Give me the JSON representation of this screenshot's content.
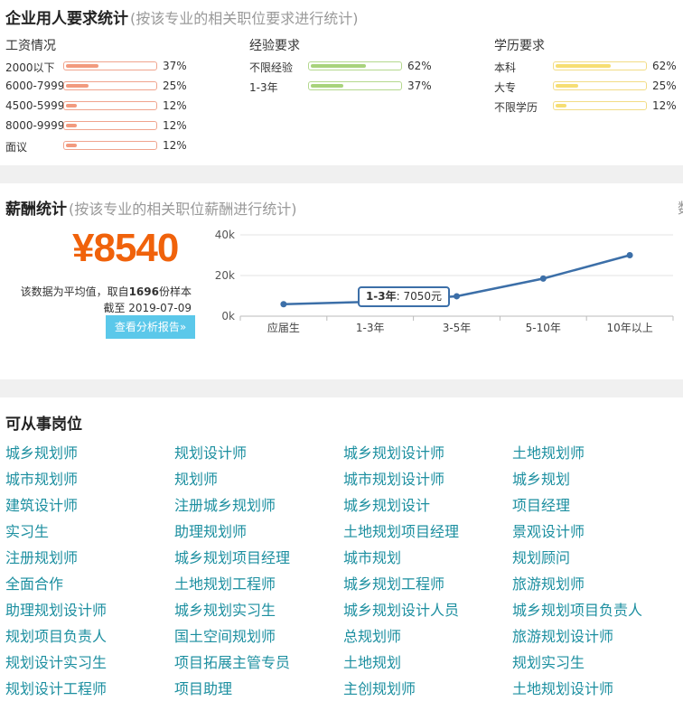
{
  "requirements": {
    "title": "企业用人要求统计",
    "subtitle": "(按该专业的相关职位要求进行统计)",
    "salary_col": {
      "title": "工资情况",
      "fill_color": "#f29a7e",
      "border_color": "#f0a48e",
      "items": [
        {
          "label": "2000以下",
          "pct": "37%",
          "value": 37
        },
        {
          "label": "6000-7999",
          "pct": "25%",
          "value": 25
        },
        {
          "label": "4500-5999",
          "pct": "12%",
          "value": 12
        },
        {
          "label": "8000-9999",
          "pct": "12%",
          "value": 12
        },
        {
          "label": "面议",
          "pct": "12%",
          "value": 12
        }
      ]
    },
    "experience_col": {
      "title": "经验要求",
      "fill_color": "#a8d37c",
      "border_color": "#b4d88e",
      "items": [
        {
          "label": "不限经验",
          "pct": "62%",
          "value": 62
        },
        {
          "label": "1-3年",
          "pct": "37%",
          "value": 37
        }
      ]
    },
    "education_col": {
      "title": "学历要求",
      "fill_color": "#f6de73",
      "border_color": "#f2dc86",
      "items": [
        {
          "label": "本科",
          "pct": "62%",
          "value": 62
        },
        {
          "label": "大专",
          "pct": "25%",
          "value": 25
        },
        {
          "label": "不限学历",
          "pct": "12%",
          "value": 12
        }
      ]
    }
  },
  "salary_stats": {
    "title": "薪酬统计",
    "subtitle": "(按该专业的相关职位薪酬进行统计)",
    "edge_text": "数",
    "amount": "¥8540",
    "note_prefix": "该数据为平均值，取自",
    "sample_count": "1696",
    "note_suffix": "份样本",
    "date_text": "截至 2019-07-09",
    "report_button": "查看分析报告»",
    "tooltip_label": "1-3年",
    "tooltip_value": ": 7050元"
  },
  "chart_data": {
    "type": "line",
    "categories": [
      "应届生",
      "1-3年",
      "3-5年",
      "5-10年",
      "10年以上"
    ],
    "series": [
      {
        "values": [
          5900,
          7050,
          9800,
          18500,
          30000
        ]
      }
    ],
    "yticks": [
      "0k",
      "20k",
      "40k"
    ],
    "ylim": [
      0,
      40000
    ],
    "grid": true,
    "line_color": "#3c6fa8"
  },
  "jobs": {
    "title": "可从事岗位",
    "rows": [
      [
        "城乡规划师",
        "规划设计师",
        "城乡规划设计师",
        "土地规划师"
      ],
      [
        "城市规划师",
        "规划师",
        "城市规划设计师",
        "城乡规划"
      ],
      [
        "建筑设计师",
        "注册城乡规划师",
        "城乡规划设计",
        "项目经理"
      ],
      [
        "实习生",
        "助理规划师",
        "土地规划项目经理",
        "景观设计师"
      ],
      [
        "注册规划师",
        "城乡规划项目经理",
        "城市规划",
        "规划顾问"
      ],
      [
        "全面合作",
        "土地规划工程师",
        "城乡规划工程师",
        "旅游规划师"
      ],
      [
        "助理规划设计师",
        "城乡规划实习生",
        "城乡规划设计人员",
        "城乡规划项目负责人"
      ],
      [
        "规划项目负责人",
        "国土空间规划师",
        "总规划师",
        "旅游规划设计师"
      ],
      [
        "规划设计实习生",
        "项目拓展主管专员",
        "土地规划",
        "规划实习生"
      ],
      [
        "规划设计工程师",
        "项目助理",
        "主创规划师",
        "土地规划设计师"
      ]
    ]
  }
}
